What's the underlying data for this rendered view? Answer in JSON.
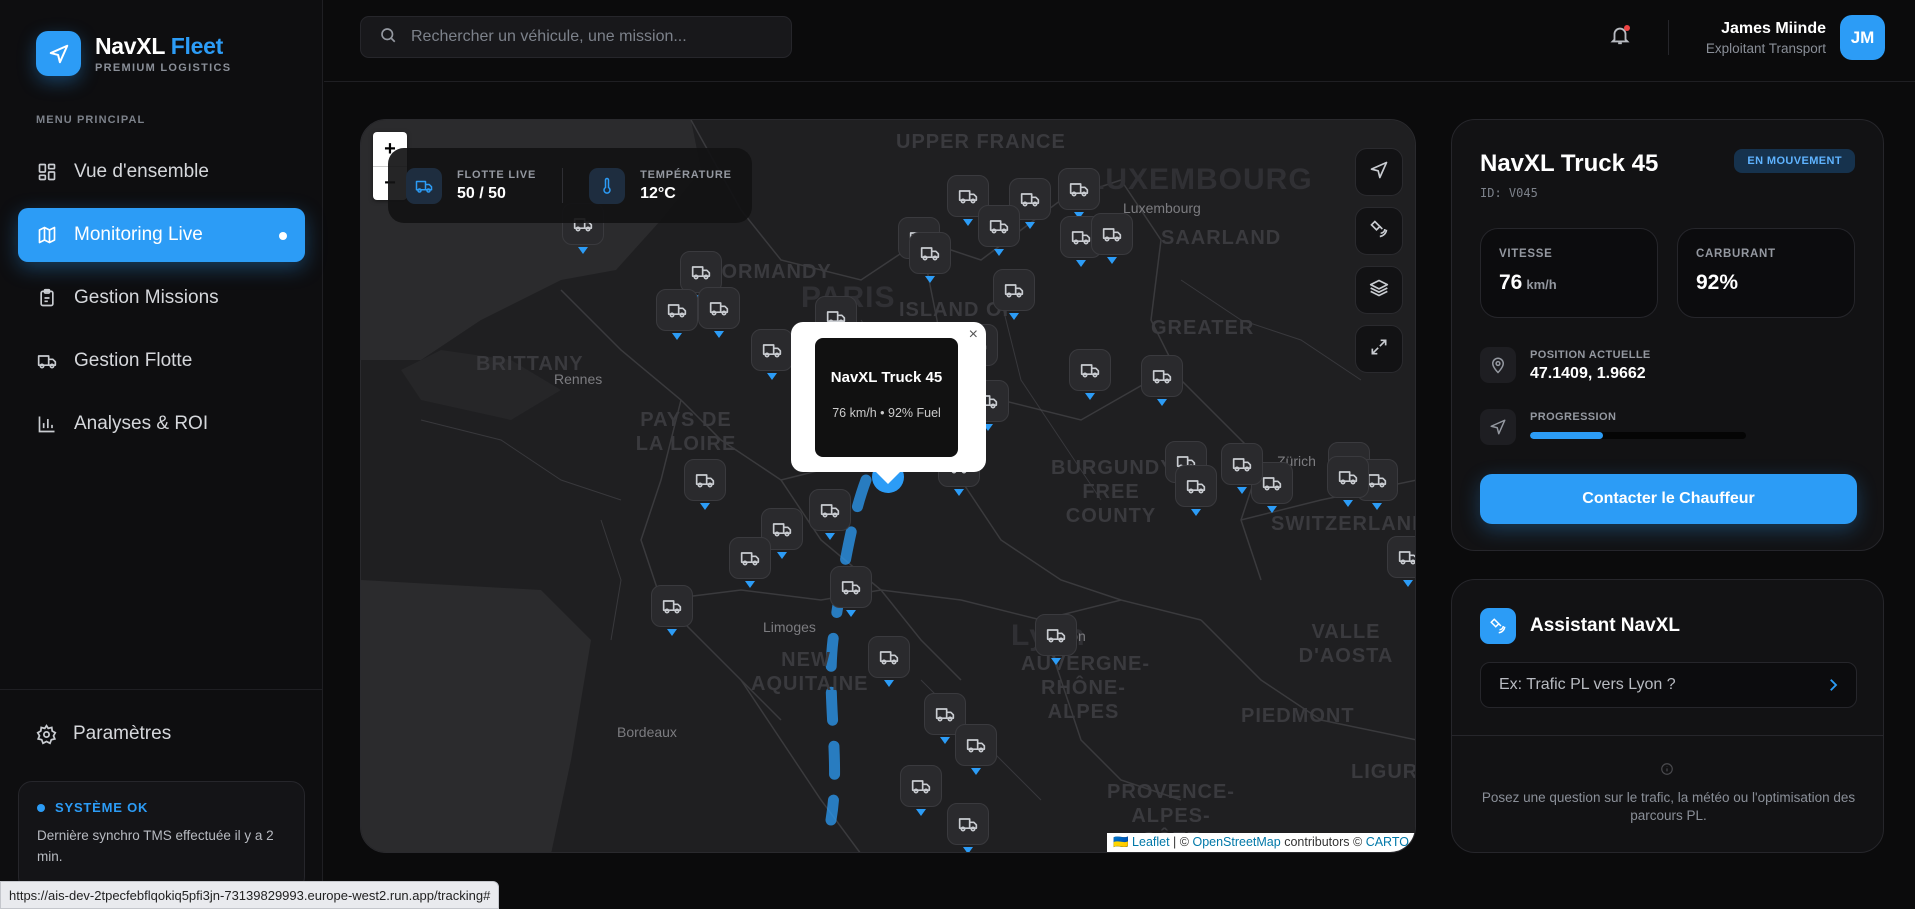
{
  "brand": {
    "name": "NavXL",
    "accent": "Fleet",
    "subtitle": "PREMIUM LOGISTICS"
  },
  "sidebar": {
    "menu_title": "MENU PRINCIPAL",
    "items": [
      {
        "label": "Vue d'ensemble",
        "icon": "grid-icon"
      },
      {
        "label": "Monitoring Live",
        "icon": "map-icon",
        "active": true
      },
      {
        "label": "Gestion Missions",
        "icon": "clipboard-icon"
      },
      {
        "label": "Gestion Flotte",
        "icon": "truck-icon"
      },
      {
        "label": "Analyses & ROI",
        "icon": "bar-chart-icon"
      }
    ],
    "settings_label": "Paramètres",
    "status": {
      "title": "SYSTÈME OK",
      "text": "Dernière synchro TMS effectuée il y a 2 min."
    }
  },
  "header": {
    "search_placeholder": "Rechercher un véhicule, une mission...",
    "user_name": "James Miinde",
    "user_role": "Exploitant Transport",
    "avatar_initials": "JM"
  },
  "map": {
    "stats": [
      {
        "label": "FLOTTE LIVE",
        "value": "50 / 50",
        "icon": "truck-icon"
      },
      {
        "label": "TEMPÉRATURE",
        "value": "12°C",
        "icon": "thermometer-icon"
      }
    ],
    "zoom_in": "+",
    "zoom_out": "−",
    "region_labels": [
      "UPPER FRANCE",
      "LUXEMBOURG",
      "SAARLAND",
      "NORMANDY",
      "PARIS",
      "ISLAND OF",
      "BRITTANY",
      "PAYS DE LA LOIRE",
      "GREATER",
      "BURGUNDY FREE COUNTY",
      "SWITZERLAND",
      "NEW AQUITAINE",
      "AUVERGNE-RHÔNE-ALPES",
      "VALLE D'AOSTA",
      "PIEDMONT",
      "PROVENCE-ALPES-CÔTE",
      "LIGURIA",
      "Lyon"
    ],
    "cities": [
      "Rennes",
      "Limoges",
      "Bordeaux",
      "Lyon",
      "Zürich",
      "Luxembourg"
    ],
    "popup": {
      "title": "NavXL Truck 45",
      "subtitle": "76 km/h • 92% Fuel",
      "close": "×"
    },
    "attribution": {
      "leaflet": "Leaflet",
      "osm": "OpenStreetMap",
      "contrib": "contributors ©",
      "carto": "CARTO"
    }
  },
  "vehicle": {
    "name": "NavXL Truck 45",
    "id": "ID: V045",
    "status": "EN MOUVEMENT",
    "speed_label": "VITESSE",
    "speed_value": "76",
    "speed_unit": "km/h",
    "fuel_label": "CARBURANT",
    "fuel_value": "92%",
    "position_label": "POSITION ACTUELLE",
    "position_value": "47.1409, 1.9662",
    "progress_label": "PROGRESSION",
    "progress": 0.34,
    "contact_button": "Contacter le Chauffeur"
  },
  "assistant": {
    "title": "Assistant NavXL",
    "input_placeholder": "Ex: Trafic PL vers Lyon ?",
    "help_text": "Posez une question sur le trafic, la météo ou l'optimisation des parcours PL."
  },
  "status_url": "https://ais-dev-2tpecfebflqokiq5pfi3jn-73139829993.europe-west2.run.app/tracking#",
  "colors": {
    "accent": "#2c9cf6",
    "background": "#0b0b0c",
    "panel": "#121214"
  }
}
